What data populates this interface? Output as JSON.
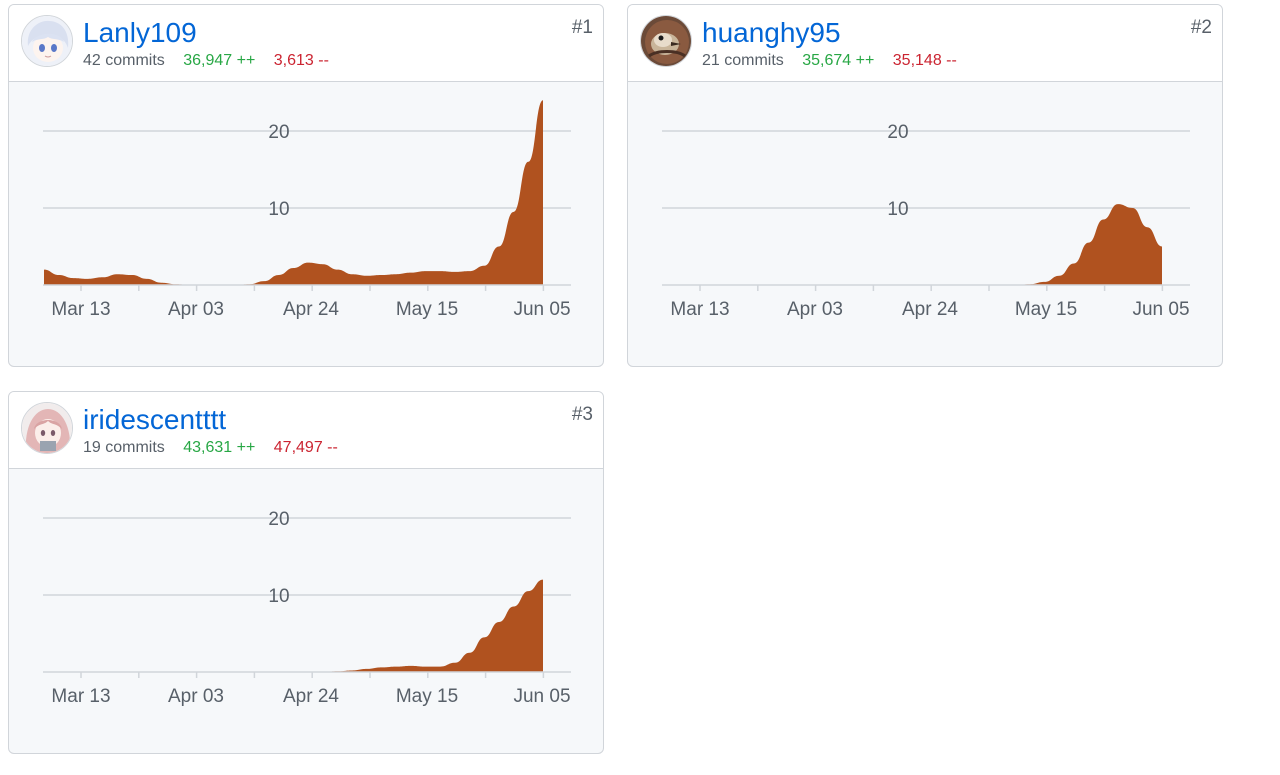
{
  "contributors": [
    {
      "username": "Lanly109",
      "commits_label": "42 commits",
      "additions_label": "36,947 ++",
      "deletions_label": "3,613 --",
      "rank": "#1",
      "avatar": "anime-girl-avatar"
    },
    {
      "username": "huanghy95",
      "commits_label": "21 commits",
      "additions_label": "35,674 ++",
      "deletions_label": "35,148 --",
      "rank": "#2",
      "avatar": "bird-photo-avatar"
    },
    {
      "username": "iridescentttt",
      "commits_label": "19 commits",
      "additions_label": "43,631 ++",
      "deletions_label": "47,497 --",
      "rank": "#3",
      "avatar": "pink-hair-avatar"
    }
  ],
  "colors": {
    "area_fill": "#b0521f",
    "link": "#0366d6",
    "additions": "#28a745",
    "deletions": "#cb2431",
    "grid": "#d1d5da",
    "axis_text": "#586069"
  },
  "chart_data": [
    {
      "type": "area",
      "x": [
        "Mar 13",
        "Apr 03",
        "Apr 24",
        "May 15",
        "Jun 05"
      ],
      "ylim": [
        0,
        24
      ],
      "yticks": [
        10,
        20
      ],
      "grid": true,
      "series": [
        {
          "x_weeks": [
            0,
            1,
            2,
            3,
            4,
            5,
            6,
            7,
            8,
            9,
            10,
            11,
            12,
            13,
            14,
            15,
            16,
            17,
            18,
            19,
            20,
            21,
            22,
            23,
            24,
            25,
            26,
            27,
            28,
            29,
            30,
            31,
            32,
            33,
            34
          ],
          "values": [
            2,
            1.3,
            0.9,
            0.8,
            1,
            1.4,
            1.3,
            0.8,
            0.3,
            0.1,
            0,
            0,
            0,
            0,
            0.1,
            0.5,
            1.3,
            2.2,
            2.9,
            2.7,
            2,
            1.4,
            1.2,
            1.3,
            1.4,
            1.6,
            1.8,
            1.8,
            1.7,
            1.8,
            2.5,
            5,
            9.5,
            16,
            24
          ]
        }
      ]
    },
    {
      "type": "area",
      "x": [
        "Mar 13",
        "Apr 03",
        "Apr 24",
        "May 15",
        "Jun 05"
      ],
      "ylim": [
        0,
        24
      ],
      "yticks": [
        10,
        20
      ],
      "grid": true,
      "series": [
        {
          "x_weeks": [
            0,
            1,
            2,
            3,
            4,
            5,
            6,
            7,
            8,
            9,
            10,
            11,
            12,
            13,
            14,
            15,
            16,
            17,
            18,
            19,
            20,
            21,
            22,
            23,
            24,
            25,
            26,
            27,
            28,
            29,
            30,
            31,
            32,
            33,
            34
          ],
          "values": [
            0,
            0,
            0,
            0,
            0,
            0,
            0,
            0,
            0,
            0,
            0,
            0,
            0,
            0,
            0,
            0,
            0,
            0,
            0,
            0,
            0,
            0,
            0,
            0,
            0,
            0.1,
            0.4,
            1.2,
            2.8,
            5.5,
            8.5,
            10.5,
            10,
            7.5,
            5
          ]
        }
      ]
    },
    {
      "type": "area",
      "x": [
        "Mar 13",
        "Apr 03",
        "Apr 24",
        "May 15",
        "Jun 05"
      ],
      "ylim": [
        0,
        24
      ],
      "yticks": [
        10,
        20
      ],
      "grid": true,
      "series": [
        {
          "x_weeks": [
            0,
            1,
            2,
            3,
            4,
            5,
            6,
            7,
            8,
            9,
            10,
            11,
            12,
            13,
            14,
            15,
            16,
            17,
            18,
            19,
            20,
            21,
            22,
            23,
            24,
            25,
            26,
            27,
            28,
            29,
            30,
            31,
            32,
            33,
            34
          ],
          "values": [
            0,
            0,
            0,
            0,
            0,
            0,
            0,
            0,
            0,
            0,
            0,
            0,
            0,
            0,
            0,
            0,
            0,
            0,
            0,
            0,
            0.1,
            0.2,
            0.4,
            0.6,
            0.7,
            0.8,
            0.7,
            0.7,
            1.2,
            2.5,
            4.5,
            6.5,
            8.5,
            10.5,
            12
          ]
        }
      ]
    }
  ]
}
